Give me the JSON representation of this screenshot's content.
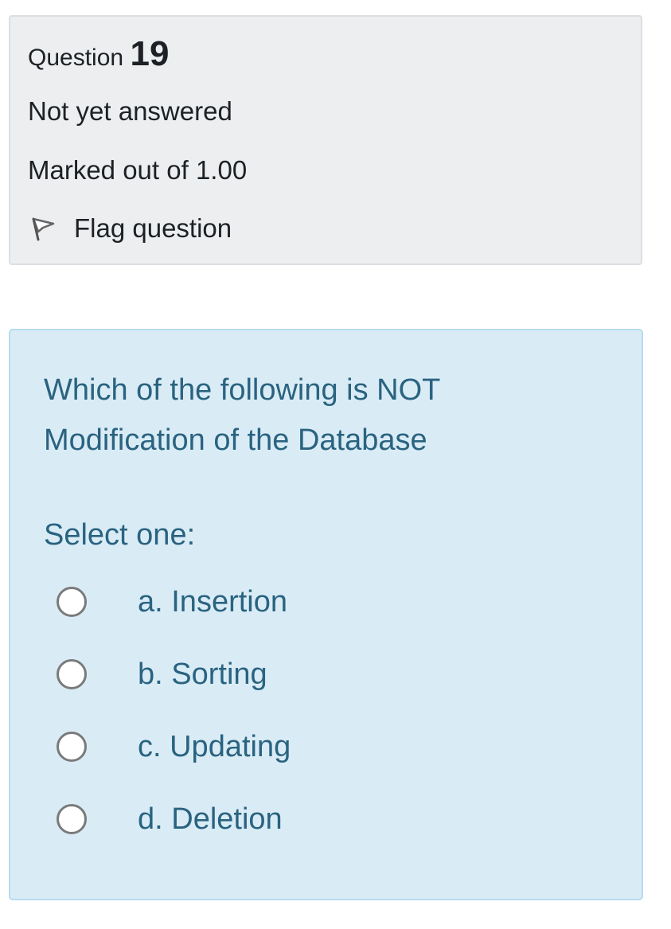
{
  "info": {
    "question_label": "Question",
    "question_number": "19",
    "state": "Not yet answered",
    "grade": "Marked out of 1.00",
    "flag_label": "Flag question",
    "flag_icon": "flag-outline-icon"
  },
  "question": {
    "text": "Which of the following is NOT Modification of the Database",
    "prompt": "Select one:",
    "options": [
      {
        "label": "a. Insertion",
        "selected": false
      },
      {
        "label": "b. Sorting",
        "selected": false
      },
      {
        "label": "c. Updating",
        "selected": false
      },
      {
        "label": "d. Deletion",
        "selected": false
      }
    ]
  },
  "colors": {
    "info_background": "#eceef0",
    "content_background": "#d9ecf6",
    "content_text": "#2a6380"
  }
}
